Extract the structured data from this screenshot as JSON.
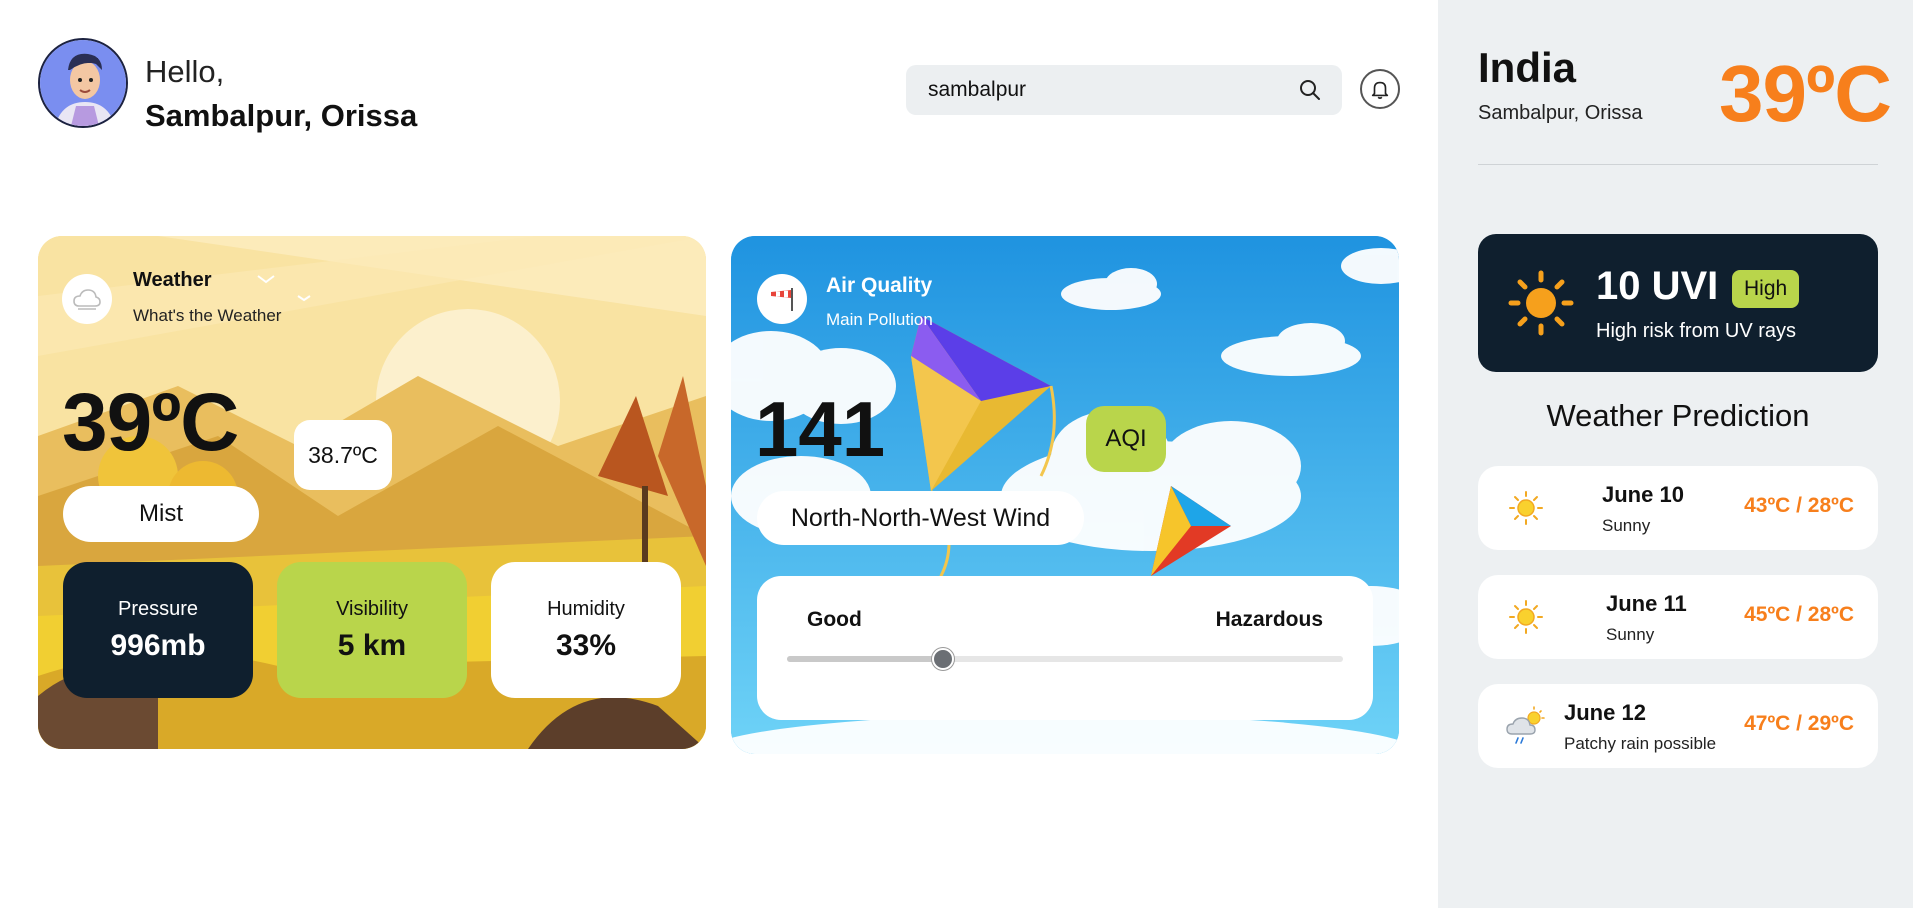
{
  "header": {
    "greeting": "Hello,",
    "location": "Sambalpur, Orissa",
    "search_value": "sambalpur"
  },
  "weather_card": {
    "title": "Weather",
    "subtitle": "What's the Weather",
    "temperature": "39ºC",
    "feels_like": "38.7ºC",
    "condition": "Mist",
    "stats": {
      "pressure": {
        "label": "Pressure",
        "value": "996mb"
      },
      "visibility": {
        "label": "Visibility",
        "value": "5 km"
      },
      "humidity": {
        "label": "Humidity",
        "value": "33%"
      }
    }
  },
  "air_quality_card": {
    "title": "Air Quality",
    "subtitle": "Main Pollution",
    "value": "141",
    "badge": "AQI",
    "wind": "North-North-West Wind",
    "scale_low": "Good",
    "scale_high": "Hazardous",
    "scale_level": 0.28
  },
  "sidebar": {
    "country": "India",
    "region": "Sambalpur, Orissa",
    "temperature": "39ºC",
    "uv": {
      "value": "10 UVI",
      "level": "High",
      "description": "High risk from UV rays"
    },
    "prediction_title": "Weather Prediction",
    "predictions": [
      {
        "date": "June 10",
        "condition": "Sunny",
        "temps": "43ºC / 28ºC",
        "icon": "sun-icon"
      },
      {
        "date": "June 11",
        "condition": "Sunny",
        "temps": "45ºC / 28ºC",
        "icon": "sun-icon"
      },
      {
        "date": "June 12",
        "condition": "Patchy rain possible",
        "temps": "47ºC / 29ºC",
        "icon": "rain-cloud-icon"
      }
    ]
  },
  "colors": {
    "accent_orange": "#f77f1c",
    "accent_green": "#b9d54b",
    "dark_navy": "#0f1f2e"
  }
}
